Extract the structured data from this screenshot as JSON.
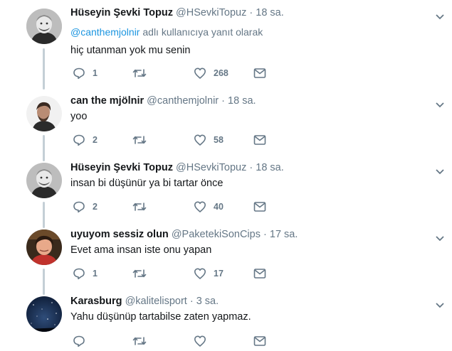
{
  "tweets": [
    {
      "name": "Hüseyin Şevki Topuz",
      "handle": "@HSevkiTopuz",
      "dot": "·",
      "time": "18 sa.",
      "reply_mention": "@canthemjolnir",
      "reply_suffix": " adlı kullanıcıya yanıt olarak",
      "text": "hiç utanman yok mu senin",
      "replies": "1",
      "retweets": "",
      "likes": "268",
      "avatar_icon": "person-avatar"
    },
    {
      "name": "can the mjölnir",
      "handle": "@canthemjolnir",
      "dot": "·",
      "time": "18 sa.",
      "text": "yoo",
      "replies": "2",
      "retweets": "",
      "likes": "58",
      "avatar_icon": "person-avatar"
    },
    {
      "name": "Hüseyin Şevki Topuz",
      "handle": "@HSevkiTopuz",
      "dot": "·",
      "time": "18 sa.",
      "text": "insan bi düşünür ya bi tartar önce",
      "replies": "2",
      "retweets": "",
      "likes": "40",
      "avatar_icon": "person-avatar"
    },
    {
      "name": "uyuyom sessiz olun",
      "handle": "@PaketekiSonCips",
      "dot": "·",
      "time": "17 sa.",
      "text": "Evet ama insan iste onu yapan",
      "replies": "1",
      "retweets": "",
      "likes": "17",
      "avatar_icon": "person-avatar"
    },
    {
      "name": "Karasburg",
      "handle": "@kalitelisport",
      "dot": "·",
      "time": "3 sa.",
      "text": "Yahu düşünüp tartabilse zaten yapmaz.",
      "replies": "",
      "retweets": "",
      "likes": "",
      "avatar_icon": "night-sky-avatar"
    }
  ],
  "colors": {
    "text": "#14171a",
    "secondary": "#657786",
    "link": "#1b95e0",
    "thread_line": "#c4cfd6"
  },
  "icons": [
    "reply-icon",
    "retweet-icon",
    "like-icon",
    "message-icon",
    "chevron-down-icon"
  ]
}
